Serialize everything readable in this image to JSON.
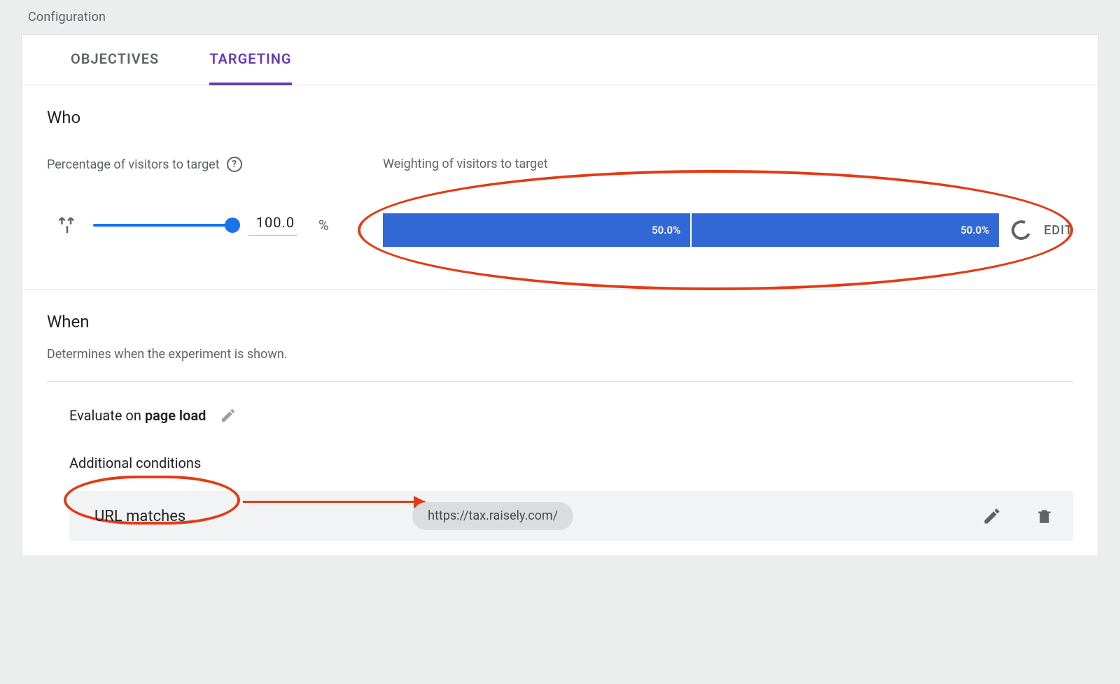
{
  "page_title": "Configuration",
  "tabs": {
    "objectives": "OBJECTIVES",
    "targeting": "TARGETING"
  },
  "who": {
    "heading": "Who",
    "percentage_label": "Percentage of visitors to target",
    "slider_value": "100.0",
    "percent_symbol": "%",
    "weighting_label": "Weighting of visitors to target",
    "segments": [
      "50.0%",
      "50.0%"
    ],
    "edit_label": "EDIT"
  },
  "when": {
    "heading": "When",
    "description": "Determines when the experiment is shown.",
    "evaluate_prefix": "Evaluate on ",
    "evaluate_value": "page load",
    "additional_conditions_label": "Additional conditions",
    "condition_label": "URL matches",
    "condition_url": "https://tax.raisely.com/"
  }
}
